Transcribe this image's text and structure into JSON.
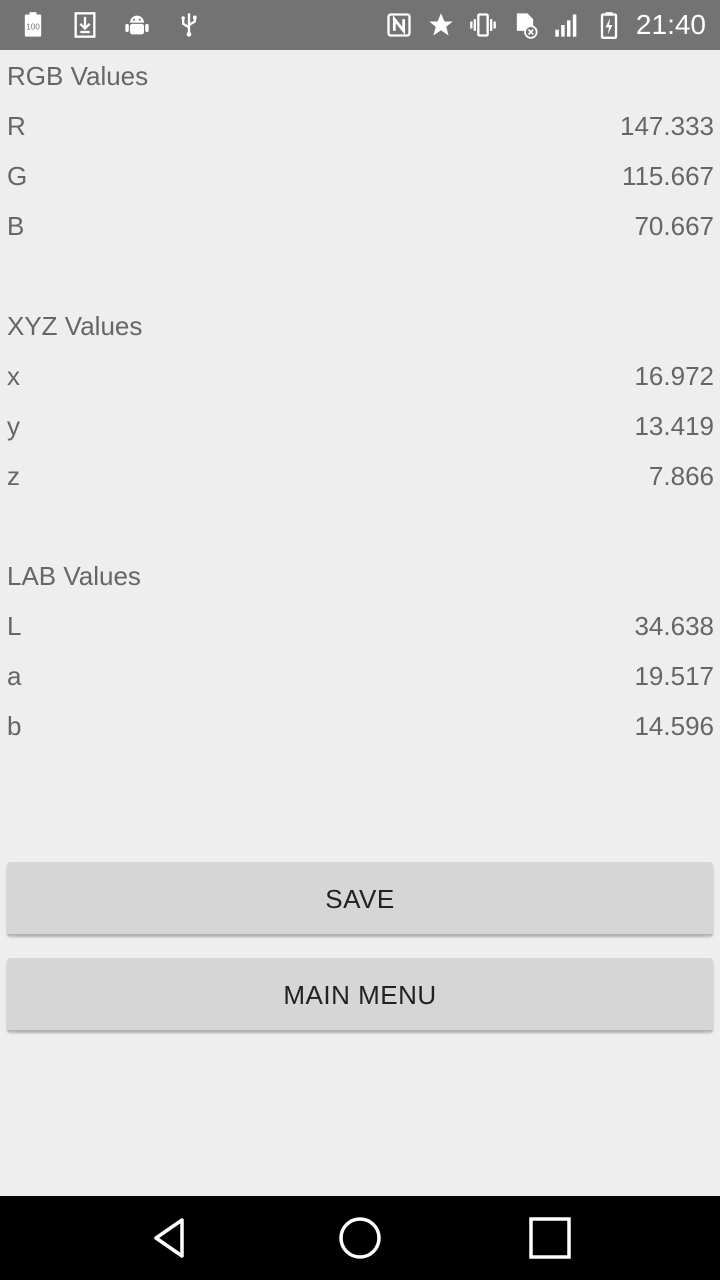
{
  "status_bar": {
    "left_icons": [
      "battery-saver-100-icon",
      "download-icon",
      "android-debug-icon",
      "usb-icon"
    ],
    "right_icons": [
      "nfc-icon",
      "star-icon",
      "vibrate-icon",
      "no-sim-icon",
      "signal-icon",
      "battery-charging-icon"
    ],
    "time": "21:40"
  },
  "sections": [
    {
      "title": "RGB Values",
      "rows": [
        {
          "label": "R",
          "value": "147.333"
        },
        {
          "label": "G",
          "value": "115.667"
        },
        {
          "label": "B",
          "value": "70.667"
        }
      ]
    },
    {
      "title": "XYZ Values",
      "rows": [
        {
          "label": "x",
          "value": "16.972"
        },
        {
          "label": "y",
          "value": "13.419"
        },
        {
          "label": "z",
          "value": "7.866"
        }
      ]
    },
    {
      "title": "LAB Values",
      "rows": [
        {
          "label": "L",
          "value": "34.638"
        },
        {
          "label": "a",
          "value": "19.517"
        },
        {
          "label": "b",
          "value": "14.596"
        }
      ]
    }
  ],
  "buttons": {
    "save_label": "SAVE",
    "main_menu_label": "MAIN MENU"
  },
  "nav_bar": {
    "icons": [
      "back-icon",
      "home-icon",
      "recents-icon"
    ]
  },
  "colors": {
    "status_bar": "#737373",
    "background": "#eeeeee",
    "text": "#666666",
    "button": "#d6d6d6",
    "nav_bar": "#000000"
  }
}
